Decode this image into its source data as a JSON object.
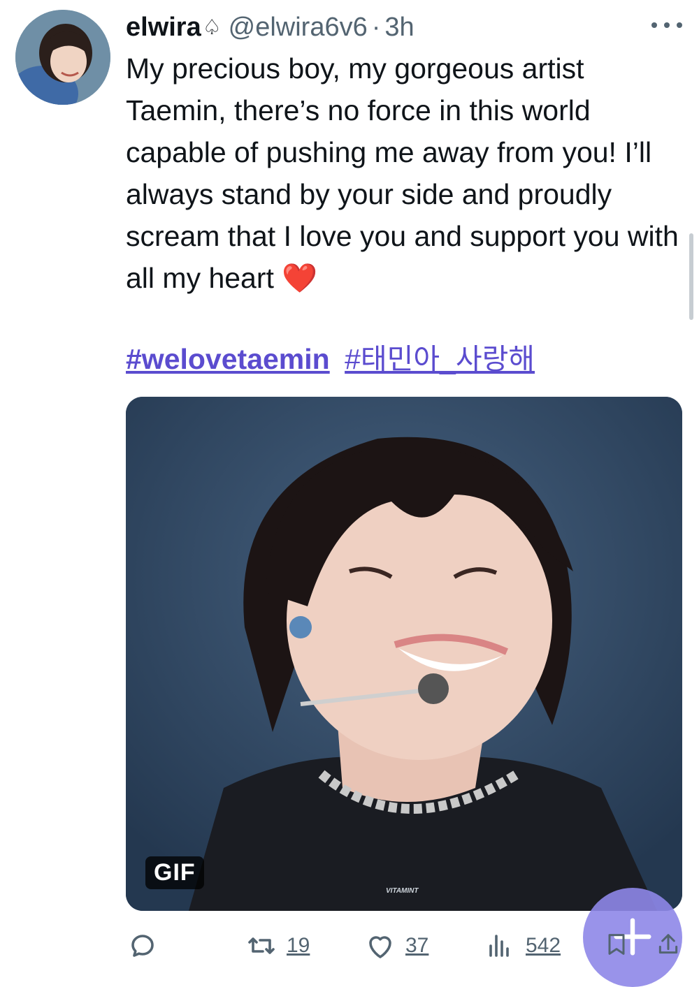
{
  "author": {
    "display_name": "elwira",
    "symbol": "♤",
    "handle": "@elwira6v6",
    "separator": "·",
    "time": "3h"
  },
  "tweet": {
    "text": "My precious boy, my gorgeous artist Taemin, there’s no force in this world capable of pushing me away from you! I’ll always stand by your side and proudly scream that I love you and support you with all my heart",
    "emoji": "❤️",
    "hashtags": [
      "#welovetaemin",
      "#태민아_사랑해"
    ]
  },
  "media": {
    "badge": "GIF",
    "watermark": "VITAMINT"
  },
  "actions": {
    "retweets": "19",
    "likes": "37",
    "views": "542"
  },
  "icons": {
    "more": "more-options-icon",
    "reply": "reply-icon",
    "retweet": "retweet-icon",
    "like": "heart-icon",
    "views": "views-icon",
    "bookmark": "bookmark-icon",
    "share": "share-icon",
    "compose": "plus-icon"
  },
  "colors": {
    "hashtag": "#5b4ccf",
    "secondary_text": "#536471",
    "fab": "#8e87e8"
  }
}
